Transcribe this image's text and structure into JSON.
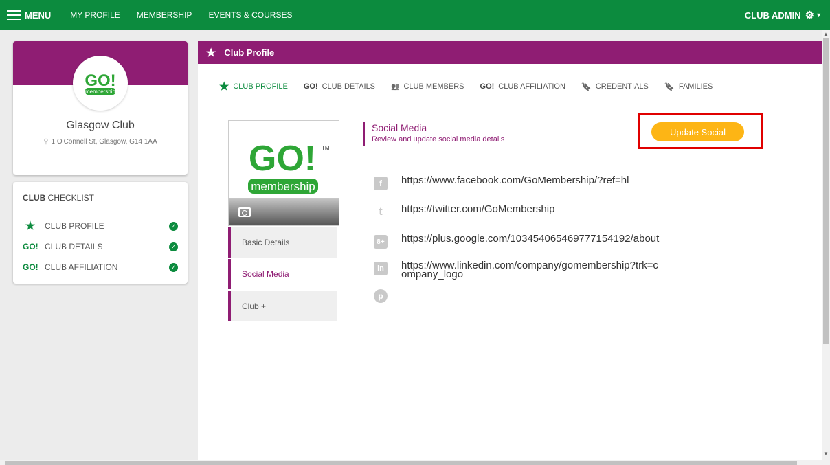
{
  "topbar": {
    "menu_label": "MENU",
    "links": [
      "MY PROFILE",
      "MEMBERSHIP",
      "EVENTS & COURSES"
    ],
    "admin_label": "CLUB ADMIN"
  },
  "club": {
    "logo_text": "GO!",
    "logo_sub": "membership",
    "logo_tm": "TM",
    "name": "Glasgow Club",
    "address": "1 O'Connell St, Glasgow, G14 1AA"
  },
  "checklist": {
    "title_bold": "CLUB",
    "title_rest": " CHECKLIST",
    "items": [
      {
        "icon": "★",
        "label": "CLUB PROFILE"
      },
      {
        "icon": "GO!",
        "label": "CLUB DETAILS"
      },
      {
        "icon": "GO!",
        "label": "CLUB AFFILIATION"
      }
    ]
  },
  "panel": {
    "title": "Club Profile",
    "tabs": [
      {
        "icon": "★",
        "label": "CLUB PROFILE"
      },
      {
        "icon": "GO!",
        "label": "CLUB DETAILS"
      },
      {
        "icon": "👥",
        "label": "CLUB MEMBERS"
      },
      {
        "icon": "GO!",
        "label": "CLUB AFFILIATION"
      },
      {
        "icon": "🔖",
        "label": "CREDENTIALS"
      },
      {
        "icon": "🔖",
        "label": "FAMILIES"
      }
    ],
    "subnav": [
      "Basic Details",
      "Social Media",
      "Club +"
    ],
    "section_title": "Social Media",
    "section_sub": "Review and update social media details",
    "update_button": "Update Social",
    "social": [
      {
        "icon": "f",
        "value": "https://www.facebook.com/GoMembership/?ref=hl"
      },
      {
        "icon": "t",
        "value": "https://twitter.com/GoMembership"
      },
      {
        "icon": "8+",
        "value": "https://plus.google.com/103454065469777154192/about"
      },
      {
        "icon": "in",
        "value": "https://www.linkedin.com/company/gomembership?trk=company_logo"
      },
      {
        "icon": "p",
        "value": ""
      }
    ]
  },
  "colors": {
    "green": "#0c8b3e",
    "purple": "#8f1d73",
    "orange": "#fdb515",
    "highlight": "#e00000"
  }
}
